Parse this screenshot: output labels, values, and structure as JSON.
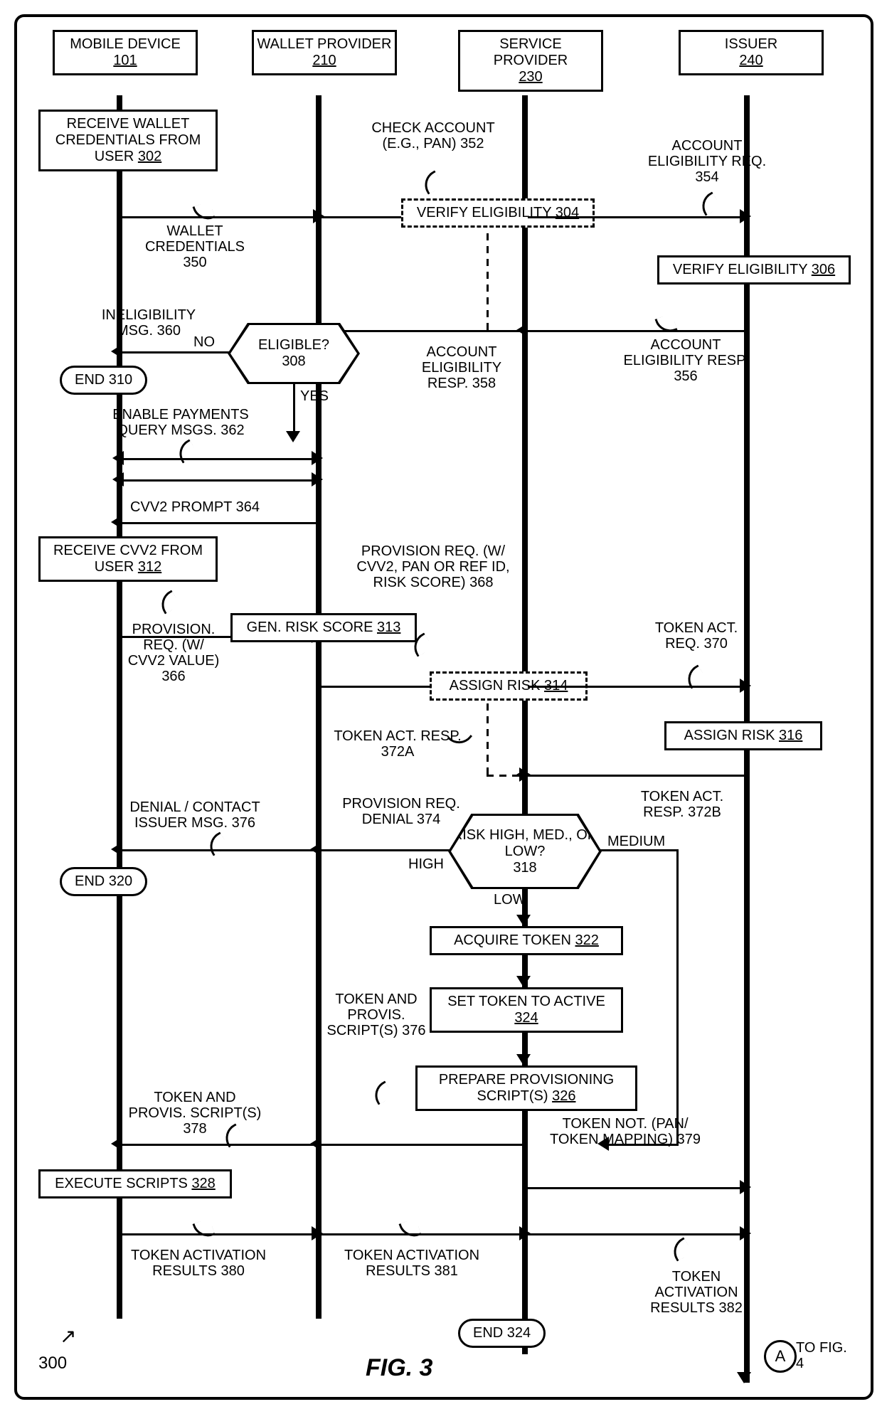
{
  "actors": {
    "mobile": {
      "title": "MOBILE DEVICE",
      "ref": "101"
    },
    "wallet": {
      "title": "WALLET PROVIDER",
      "ref": "210"
    },
    "service": {
      "title": "SERVICE PROVIDER",
      "ref": "230"
    },
    "issuer": {
      "title": "ISSUER",
      "ref": "240"
    }
  },
  "boxes": {
    "b302": {
      "text": "RECEIVE WALLET CREDENTIALS FROM USER",
      "ref": "302"
    },
    "b304": {
      "text": "VERIFY ELIGIBILITY",
      "ref": "304"
    },
    "b306": {
      "text": "VERIFY ELIGIBILITY",
      "ref": "306"
    },
    "b310": {
      "text": "END",
      "ref": "310"
    },
    "b312": {
      "text": "RECEIVE CVV2 FROM USER",
      "ref": "312"
    },
    "b313": {
      "text": "GEN. RISK SCORE",
      "ref": "313"
    },
    "b314": {
      "text": "ASSIGN RISK",
      "ref": "314"
    },
    "b316": {
      "text": "ASSIGN RISK",
      "ref": "316"
    },
    "b320": {
      "text": "END",
      "ref": "320"
    },
    "b322": {
      "text": "ACQUIRE TOKEN",
      "ref": "322"
    },
    "b324a": {
      "text": "SET TOKEN TO ACTIVE",
      "ref": "324"
    },
    "b326": {
      "text": "PREPARE PROVISIONING SCRIPT(S)",
      "ref": "326"
    },
    "b328": {
      "text": "EXECUTE SCRIPTS",
      "ref": "328"
    },
    "b324b": {
      "text": "END",
      "ref": "324"
    }
  },
  "decisions": {
    "d308": {
      "text": "ELIGIBLE?",
      "ref": "308",
      "yes": "YES",
      "no": "NO"
    },
    "d318": {
      "text": "RISK HIGH, MED., OR LOW?",
      "ref": "318",
      "high": "HIGH",
      "med": "MEDIUM",
      "low": "LOW"
    }
  },
  "labels": {
    "l350": "WALLET CREDENTIALS 350",
    "l352": "CHECK ACCOUNT (E.G., PAN) 352",
    "l354": "ACCOUNT ELIGIBILITY REQ. 354",
    "l356": "ACCOUNT ELIGIBILITY RESP. 356",
    "l358": "ACCOUNT ELIGIBILITY RESP. 358",
    "l360": "INELIGIBILITY MSG. 360",
    "l362": "ENABLE PAYMENTS QUERY MSGS. 362",
    "l364": "CVV2 PROMPT 364",
    "l366": "PROVISION. REQ. (W/ CVV2 VALUE) 366",
    "l368": "PROVISION REQ. (W/ CVV2, PAN OR REF ID, RISK SCORE) 368",
    "l370": "TOKEN ACT. REQ. 370",
    "l372a": "TOKEN ACT. RESP. 372A",
    "l372b": "TOKEN ACT. RESP. 372B",
    "l374": "PROVISION REQ. DENIAL 374",
    "l376a": "DENIAL / CONTACT ISSUER MSG. 376",
    "l376b": "TOKEN AND PROVIS. SCRIPT(S) 376",
    "l378": "TOKEN AND PROVIS. SCRIPT(S) 378",
    "l379": "TOKEN NOT. (PAN/ TOKEN MAPPING) 379",
    "l380": "TOKEN ACTIVATION RESULTS 380",
    "l381": "TOKEN ACTIVATION RESULTS 381",
    "l382": "TOKEN ACTIVATION RESULTS 382"
  },
  "footer": {
    "num": "300",
    "figlabel": "FIG. 3",
    "to": "TO FIG. 4",
    "connector": "A"
  },
  "chart_data": {
    "type": "sequence_flowchart",
    "actors": [
      "MOBILE DEVICE 101",
      "WALLET PROVIDER 210",
      "SERVICE PROVIDER 230",
      "ISSUER 240"
    ],
    "steps": [
      {
        "id": 302,
        "at": "mobile",
        "type": "process",
        "text": "RECEIVE WALLET CREDENTIALS FROM USER"
      },
      {
        "id": 350,
        "type": "message",
        "from": "mobile",
        "to": "wallet",
        "text": "WALLET CREDENTIALS"
      },
      {
        "id": 352,
        "type": "message",
        "from": "wallet",
        "to": "service",
        "text": "CHECK ACCOUNT (E.G., PAN)"
      },
      {
        "id": 304,
        "at": "service",
        "type": "process",
        "dashed": true,
        "text": "VERIFY ELIGIBILITY"
      },
      {
        "id": 354,
        "type": "message",
        "from": "service",
        "to": "issuer",
        "text": "ACCOUNT ELIGIBILITY REQ."
      },
      {
        "id": 306,
        "at": "issuer",
        "type": "process",
        "text": "VERIFY ELIGIBILITY"
      },
      {
        "id": 356,
        "type": "message",
        "from": "issuer",
        "to": "service",
        "text": "ACCOUNT ELIGIBILITY RESP."
      },
      {
        "id": 358,
        "type": "message",
        "from": "service",
        "to": "wallet",
        "text": "ACCOUNT ELIGIBILITY RESP."
      },
      {
        "id": 308,
        "at": "wallet",
        "type": "decision",
        "text": "ELIGIBLE?",
        "branches": {
          "NO": 310,
          "YES": 362
        }
      },
      {
        "id": 360,
        "type": "message",
        "from": "wallet",
        "to": "mobile",
        "text": "INELIGIBILITY MSG."
      },
      {
        "id": 310,
        "at": "mobile",
        "type": "terminator",
        "text": "END"
      },
      {
        "id": 362,
        "type": "message",
        "bidirectional": true,
        "from": "mobile",
        "to": "wallet",
        "text": "ENABLE PAYMENTS QUERY MSGS."
      },
      {
        "id": 364,
        "type": "message",
        "from": "wallet",
        "to": "mobile",
        "text": "CVV2 PROMPT"
      },
      {
        "id": 312,
        "at": "mobile",
        "type": "process",
        "text": "RECEIVE CVV2 FROM USER"
      },
      {
        "id": 366,
        "type": "message",
        "from": "mobile",
        "to": "wallet",
        "text": "PROVISION. REQ. (W/ CVV2 VALUE)"
      },
      {
        "id": 313,
        "at": "wallet",
        "type": "process",
        "text": "GEN. RISK SCORE"
      },
      {
        "id": 368,
        "type": "message",
        "from": "wallet",
        "to": "service",
        "text": "PROVISION REQ. (W/ CVV2, PAN OR REF ID, RISK SCORE)"
      },
      {
        "id": 314,
        "at": "service",
        "type": "process",
        "dashed": true,
        "text": "ASSIGN RISK"
      },
      {
        "id": 370,
        "type": "message",
        "from": "service",
        "to": "issuer",
        "text": "TOKEN ACT. REQ."
      },
      {
        "id": 316,
        "at": "issuer",
        "type": "process",
        "text": "ASSIGN RISK"
      },
      {
        "id": "372A",
        "type": "message",
        "from": "service",
        "to": "service",
        "dashed": true,
        "text": "TOKEN ACT. RESP."
      },
      {
        "id": "372B",
        "type": "message",
        "from": "issuer",
        "to": "service",
        "text": "TOKEN ACT. RESP."
      },
      {
        "id": 318,
        "at": "service",
        "type": "decision",
        "text": "RISK HIGH, MED., OR LOW?",
        "branches": {
          "HIGH": 374,
          "MEDIUM": "MEDIUM_PATH",
          "LOW": 322
        }
      },
      {
        "id": 374,
        "type": "message",
        "from": "service",
        "to": "wallet",
        "text": "PROVISION REQ. DENIAL"
      },
      {
        "id": "376_msg",
        "type": "message",
        "from": "wallet",
        "to": "mobile",
        "text": "DENIAL / CONTACT ISSUER MSG. 376"
      },
      {
        "id": 320,
        "at": "mobile",
        "type": "terminator",
        "text": "END"
      },
      {
        "id": 322,
        "at": "service",
        "type": "process",
        "text": "ACQUIRE TOKEN"
      },
      {
        "id": "324_active",
        "at": "service",
        "type": "process",
        "text": "SET TOKEN TO ACTIVE"
      },
      {
        "id": 326,
        "at": "service",
        "type": "process",
        "text": "PREPARE PROVISIONING SCRIPT(S)"
      },
      {
        "id": "376_scripts",
        "type": "message",
        "from": "service",
        "to": "wallet",
        "text": "TOKEN AND PROVIS. SCRIPT(S) 376"
      },
      {
        "id": 378,
        "type": "message",
        "from": "wallet",
        "to": "mobile",
        "text": "TOKEN AND PROVIS. SCRIPT(S)"
      },
      {
        "id": 379,
        "type": "message",
        "from": "service",
        "to": "issuer",
        "text": "TOKEN NOT. (PAN/ TOKEN MAPPING)"
      },
      {
        "id": 328,
        "at": "mobile",
        "type": "process",
        "text": "EXECUTE SCRIPTS"
      },
      {
        "id": 380,
        "type": "message",
        "from": "mobile",
        "to": "wallet",
        "text": "TOKEN ACTIVATION RESULTS"
      },
      {
        "id": 381,
        "type": "message",
        "from": "wallet",
        "to": "service",
        "text": "TOKEN ACTIVATION RESULTS"
      },
      {
        "id": 382,
        "type": "message",
        "from": "service",
        "to": "issuer",
        "text": "TOKEN ACTIVATION RESULTS"
      },
      {
        "id": "324_end",
        "at": "service",
        "type": "terminator",
        "text": "END"
      },
      {
        "id": "A",
        "type": "offpage",
        "text": "TO FIG. 4"
      }
    ]
  }
}
